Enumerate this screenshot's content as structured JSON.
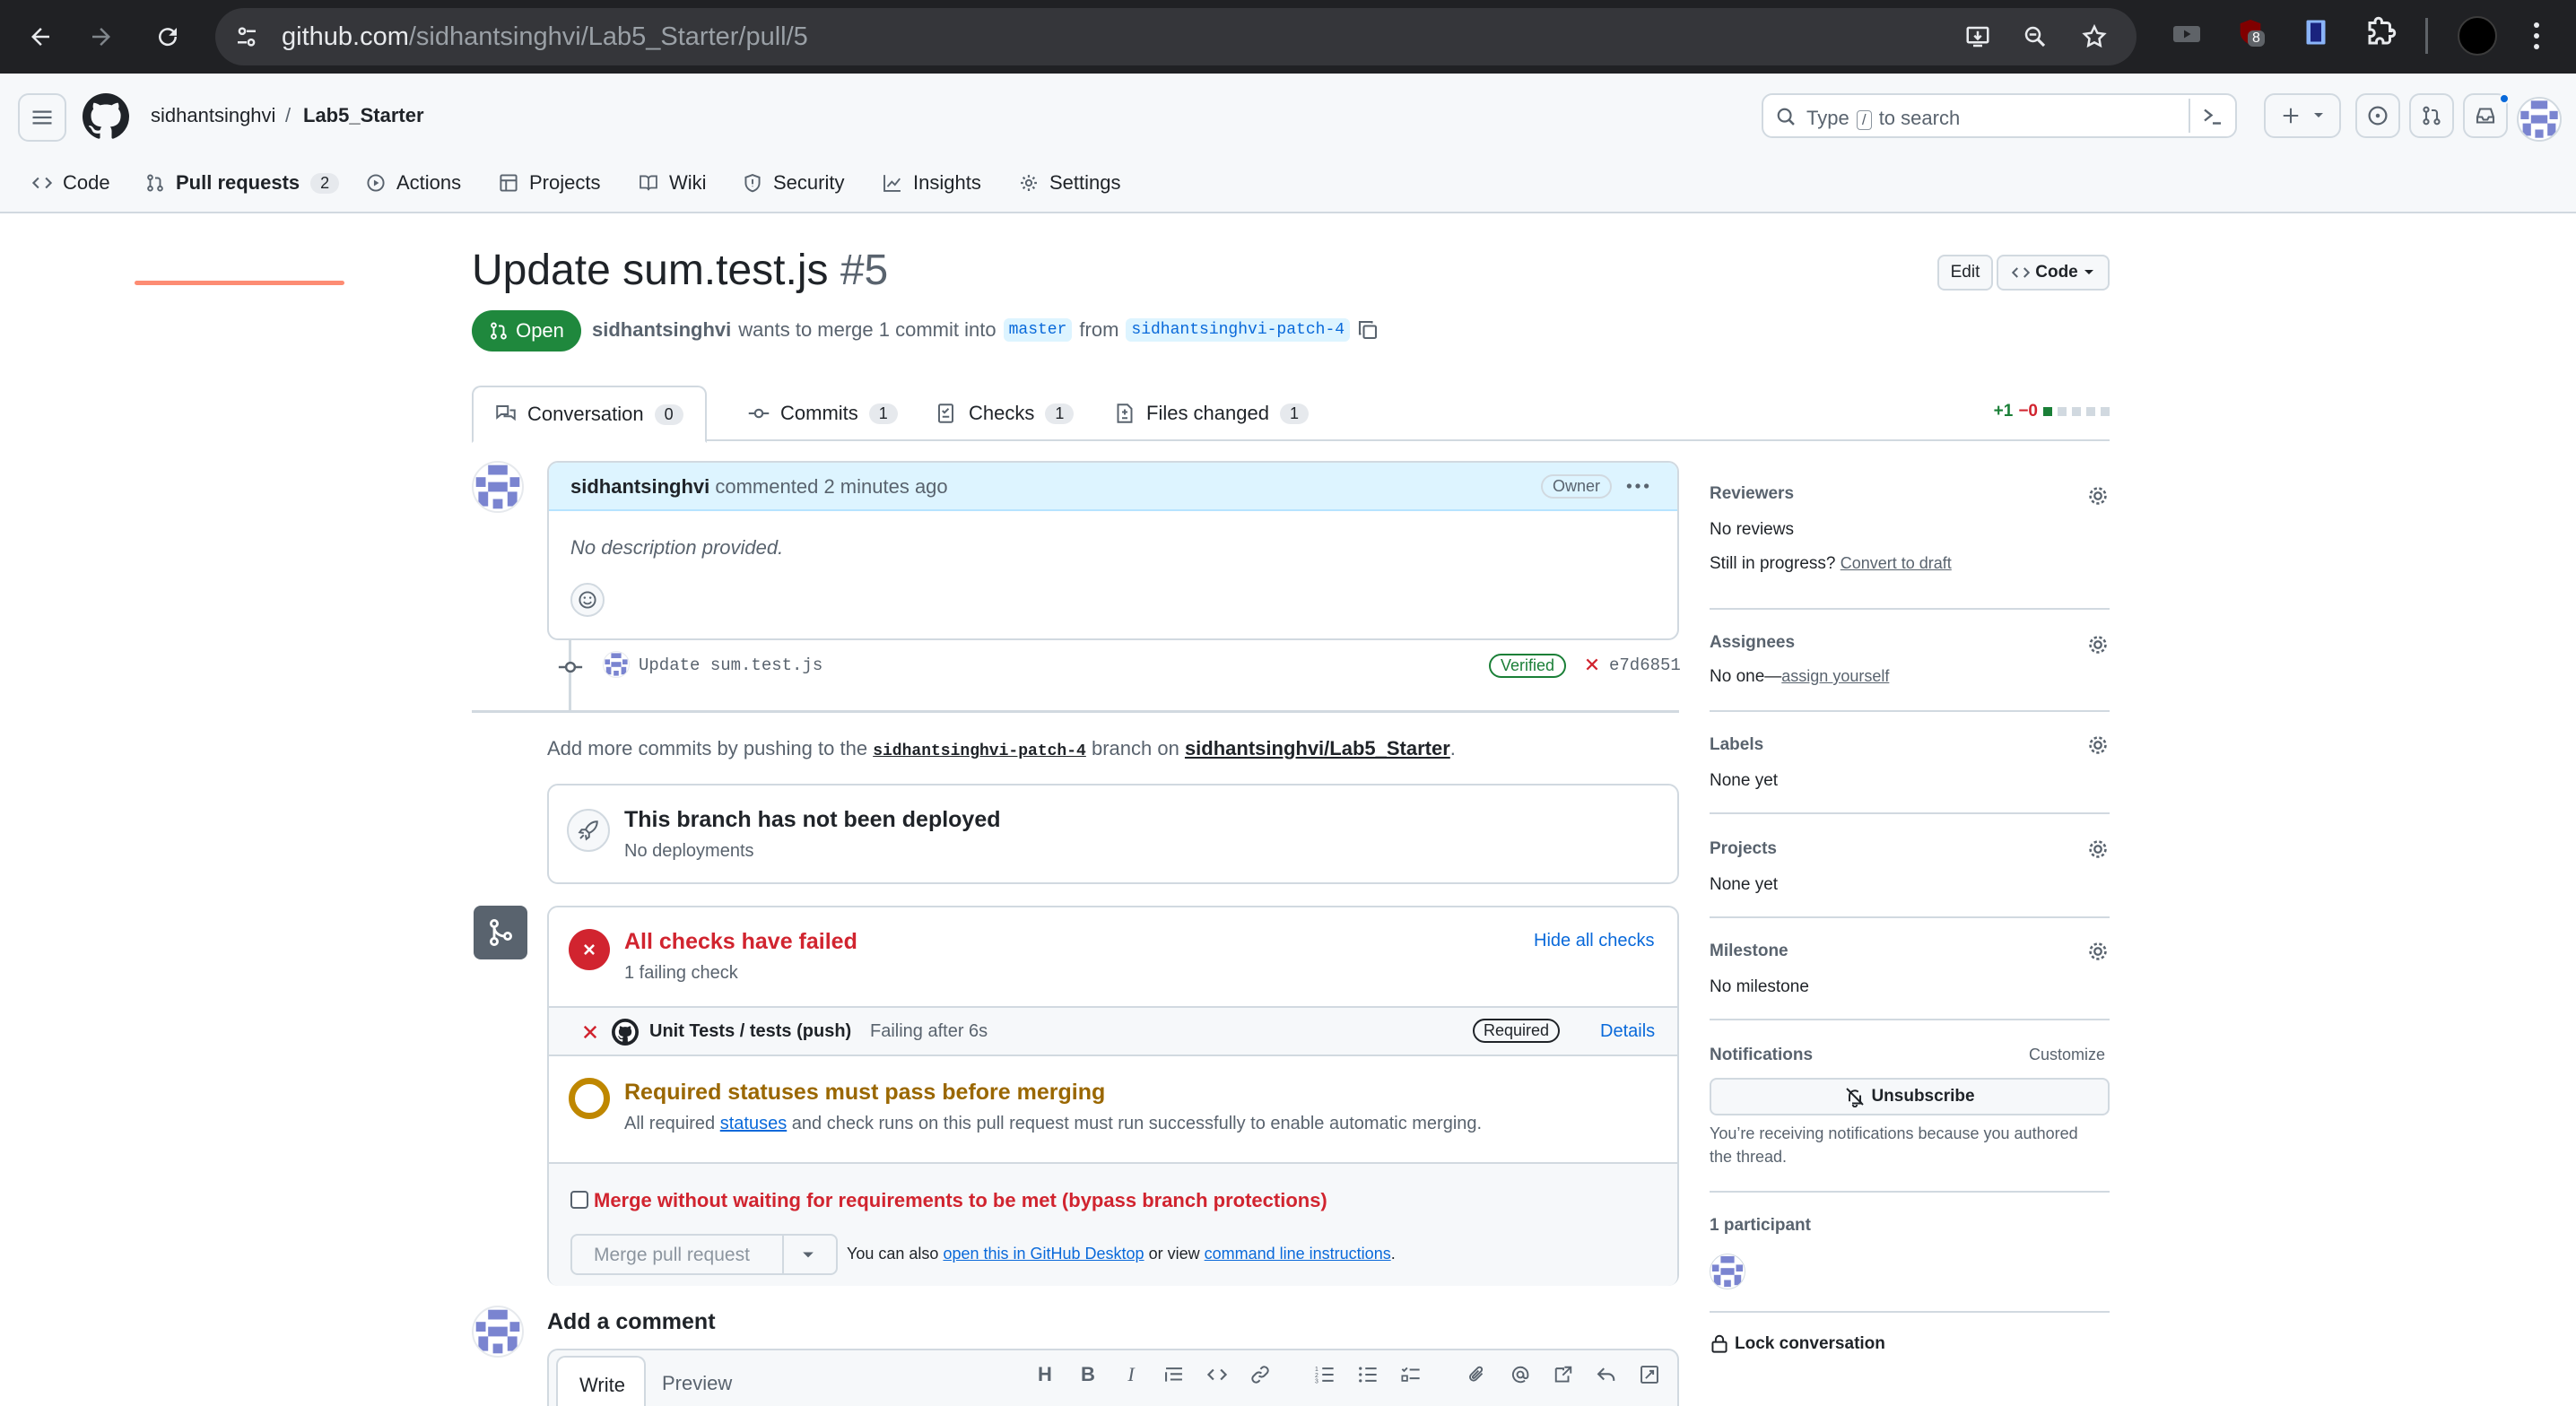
{
  "browser": {
    "url_host": "github.com",
    "url_path": "/sidhantsinghvi/Lab5_Starter/pull/5",
    "extension_badge": "8"
  },
  "header": {
    "owner": "sidhantsinghvi",
    "separator": "/",
    "repo": "Lab5_Starter",
    "search_prefix": "Type",
    "search_key": "/",
    "search_suffix": "to search"
  },
  "repo_tabs": [
    {
      "label": "Code"
    },
    {
      "label": "Pull requests",
      "count": "2"
    },
    {
      "label": "Actions"
    },
    {
      "label": "Projects"
    },
    {
      "label": "Wiki"
    },
    {
      "label": "Security"
    },
    {
      "label": "Insights"
    },
    {
      "label": "Settings"
    }
  ],
  "pr": {
    "title": "Update sum.test.js",
    "number": "#5",
    "edit_label": "Edit",
    "code_label": "Code",
    "state": "Open",
    "author": "sidhantsinghvi",
    "merge_text": "wants to merge 1 commit into",
    "base_branch": "master",
    "from_text": "from",
    "head_branch": "sidhantsinghvi-patch-4"
  },
  "pr_tabs": [
    {
      "label": "Conversation",
      "count": "0"
    },
    {
      "label": "Commits",
      "count": "1"
    },
    {
      "label": "Checks",
      "count": "1"
    },
    {
      "label": "Files changed",
      "count": "1"
    }
  ],
  "diffstat": {
    "additions": "+1",
    "deletions": "−0"
  },
  "comment": {
    "author": "sidhantsinghvi",
    "action": "commented",
    "time": "2 minutes ago",
    "role": "Owner",
    "body": "No description provided."
  },
  "commit": {
    "message": "Update sum.test.js",
    "verified": "Verified",
    "sha": "e7d6851"
  },
  "push_hint": {
    "prefix": "Add more commits by pushing to the",
    "branch": "sidhantsinghvi-patch-4",
    "middle": "branch on",
    "repo": "sidhantsinghvi/Lab5_Starter",
    "suffix": "."
  },
  "deploy": {
    "title": "This branch has not been deployed",
    "subtitle": "No deployments"
  },
  "checks": {
    "title": "All checks have failed",
    "subtitle": "1 failing check",
    "hide_label": "Hide all checks",
    "check_name": "Unit Tests / tests (push)",
    "check_status": "Failing after 6s",
    "required_badge": "Required",
    "details_label": "Details",
    "status_colors": {
      "failed": "#d1242f",
      "pending": "#9a6700"
    }
  },
  "required": {
    "title": "Required statuses must pass before merging",
    "prefix": "All required",
    "link": "statuses",
    "suffix": "and check runs on this pull request must run successfully to enable automatic merging."
  },
  "merge": {
    "bypass_label": "Merge without waiting for requirements to be met (bypass branch protections)",
    "button_label": "Merge pull request",
    "also_prefix": "You can also",
    "desktop_link": "open this in GitHub Desktop",
    "or_view": "or view",
    "cli_link": "command line instructions",
    "period": "."
  },
  "add_comment": {
    "title": "Add a comment",
    "write_tab": "Write",
    "preview_tab": "Preview"
  },
  "sidebar": {
    "reviewers": {
      "heading": "Reviewers",
      "value": "No reviews",
      "progress": "Still in progress?",
      "draft_link": "Convert to draft"
    },
    "assignees": {
      "heading": "Assignees",
      "prefix": "No one—",
      "link": "assign yourself"
    },
    "labels": {
      "heading": "Labels",
      "value": "None yet"
    },
    "projects": {
      "heading": "Projects",
      "value": "None yet"
    },
    "milestone": {
      "heading": "Milestone",
      "value": "No milestone"
    },
    "notifications": {
      "heading": "Notifications",
      "customize": "Customize",
      "button": "Unsubscribe",
      "reason_line1": "You’re receiving notifications because you authored",
      "reason_line2": "the thread."
    },
    "participants": {
      "heading": "1 participant"
    },
    "lock": "Lock conversation"
  }
}
